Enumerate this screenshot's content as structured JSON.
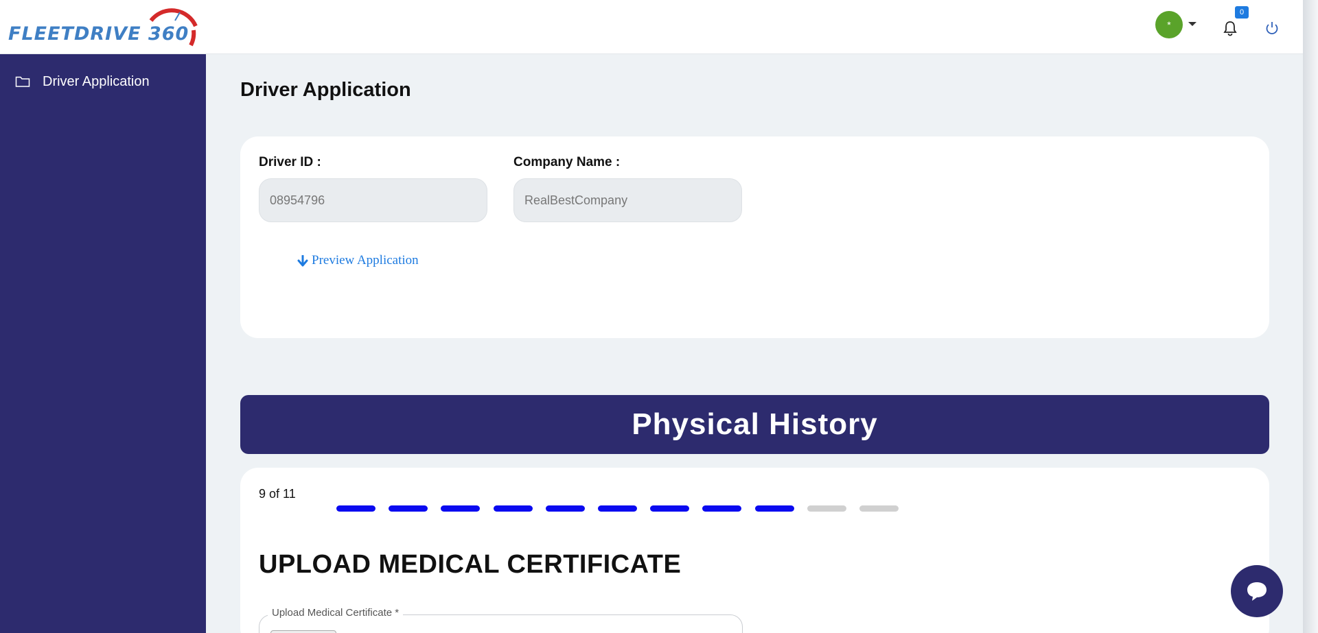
{
  "header": {
    "logo_text": "FLEETDRIVE 360",
    "avatar_text": "*",
    "notifications_count": "0"
  },
  "sidebar": {
    "items": [
      {
        "label": "Driver Application",
        "icon": "folder-icon"
      }
    ]
  },
  "main": {
    "page_title": "Driver Application",
    "driver_id_label": "Driver ID :",
    "driver_id_value": "08954796",
    "company_name_label": "Company Name :",
    "company_name_value": "RealBestCompany",
    "preview_label": "Preview Application",
    "section_banner": "Physical History",
    "step_text": "9 of 11",
    "steps_total": 11,
    "steps_completed": 9,
    "section_title": "UPLOAD MEDICAL CERTIFICATE",
    "upload_label": "Upload Medical Certificate *"
  },
  "colors": {
    "sidebar": "#2d2b6e",
    "step_active": "#0a0af0",
    "step_inactive": "#d0d0d0",
    "link": "#1e7be0",
    "avatar": "#5aa32a"
  }
}
